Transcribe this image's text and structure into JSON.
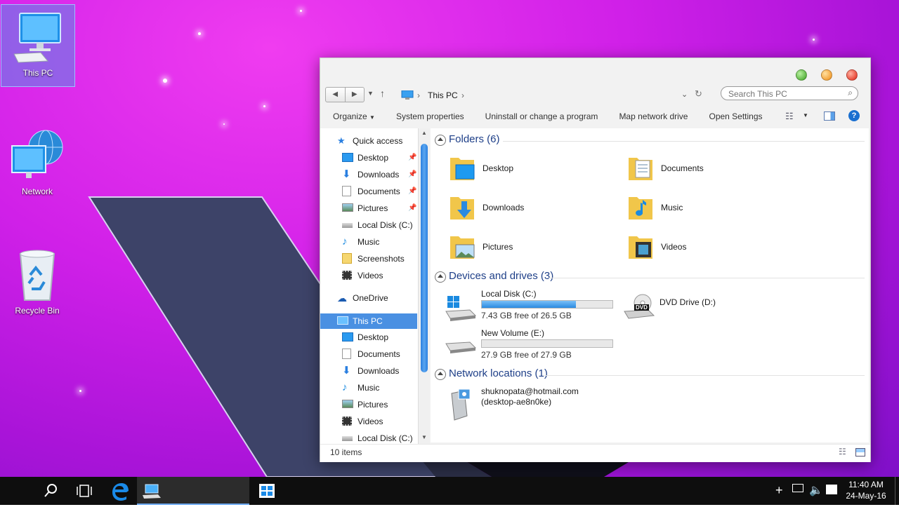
{
  "desktop": {
    "icons": [
      {
        "label": "This PC"
      },
      {
        "label": "Network"
      },
      {
        "label": "Recycle Bin"
      }
    ]
  },
  "window": {
    "address": {
      "path": "This PC"
    },
    "search": {
      "placeholder": "Search This PC"
    },
    "toolbar": {
      "organize": "Organize",
      "system_properties": "System properties",
      "uninstall": "Uninstall or change a program",
      "map_drive": "Map network drive",
      "open_settings": "Open Settings"
    },
    "nav": {
      "items": [
        {
          "label": "Quick access"
        },
        {
          "label": "Desktop"
        },
        {
          "label": "Downloads"
        },
        {
          "label": "Documents"
        },
        {
          "label": "Pictures"
        },
        {
          "label": "Local Disk (C:)"
        },
        {
          "label": "Music"
        },
        {
          "label": "Screenshots"
        },
        {
          "label": "Videos"
        },
        {
          "label": "OneDrive"
        },
        {
          "label": "This PC"
        },
        {
          "label": "Desktop"
        },
        {
          "label": "Documents"
        },
        {
          "label": "Downloads"
        },
        {
          "label": "Music"
        },
        {
          "label": "Pictures"
        },
        {
          "label": "Videos"
        },
        {
          "label": "Local Disk (C:)"
        }
      ]
    },
    "groups": {
      "folders": {
        "title": "Folders (6)",
        "items": [
          {
            "label": "Desktop"
          },
          {
            "label": "Documents"
          },
          {
            "label": "Downloads"
          },
          {
            "label": "Music"
          },
          {
            "label": "Pictures"
          },
          {
            "label": "Videos"
          }
        ]
      },
      "devices": {
        "title": "Devices and drives (3)",
        "drives": [
          {
            "name": "Local Disk (C:)",
            "free": "7.43 GB free of 26.5 GB",
            "used_fraction": 0.72
          },
          {
            "name": "DVD Drive (D:)"
          },
          {
            "name": "New Volume (E:)",
            "free": "27.9 GB free of 27.9 GB",
            "used_fraction": 0.0
          }
        ],
        "dvd_badge": "DVD"
      },
      "network": {
        "title": "Network locations (1)",
        "items": [
          {
            "line1": "shuknopata@hotmail.com",
            "line2": "(desktop-ae8n0ke)"
          }
        ]
      }
    },
    "status": {
      "count": "10 items"
    }
  },
  "taskbar": {
    "time": "11:40 AM",
    "date": "24-May-16"
  },
  "colors": {
    "accent": "#4a90e2",
    "progress": "#2a8ae0",
    "group_header": "#1e3f88"
  }
}
